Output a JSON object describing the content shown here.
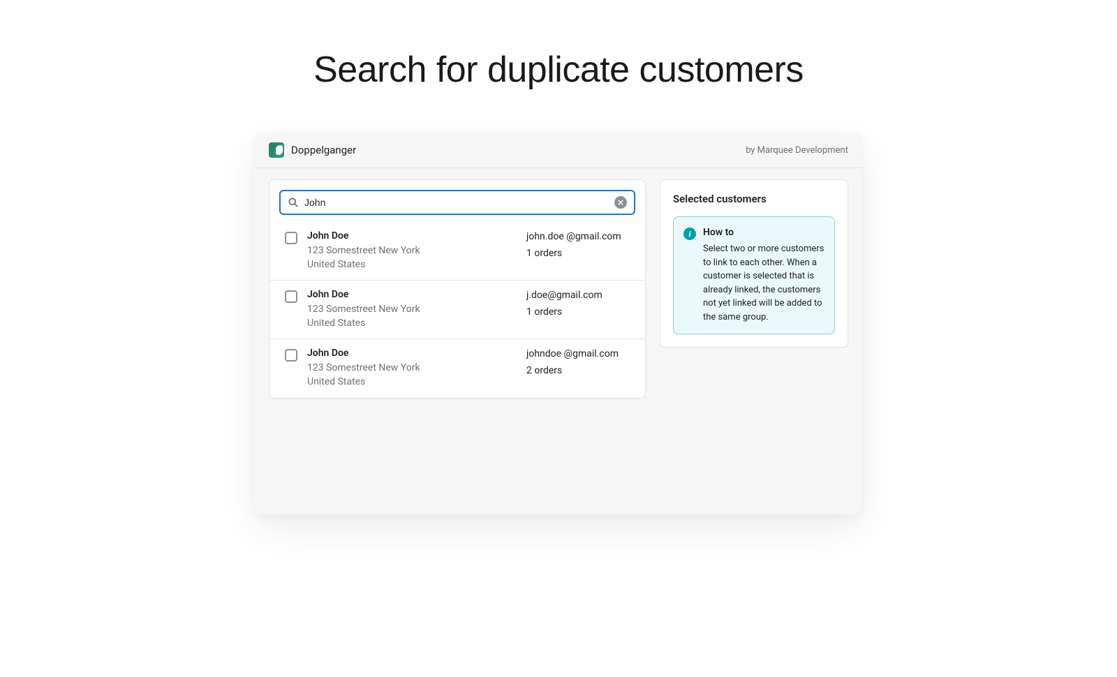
{
  "page": {
    "title": "Search for duplicate customers"
  },
  "header": {
    "app_name": "Doppelganger",
    "by_line": "by Marquee Development"
  },
  "search": {
    "value": "John"
  },
  "results": [
    {
      "name": "John Doe",
      "address": "123 Somestreet New York United States",
      "email": "john.doe @gmail.com",
      "orders": "1 orders"
    },
    {
      "name": "John Doe",
      "address": "123 Somestreet New York United States",
      "email": "j.doe@gmail.com",
      "orders": "1 orders"
    },
    {
      "name": "John Doe",
      "address": "123 Somestreet New York United States",
      "email": "johndoe @gmail.com",
      "orders": "2 orders"
    }
  ],
  "sidebar": {
    "title": "Selected customers",
    "howto_title": "How to",
    "howto_text": "Select two or more customers to link to each other. When a customer is selected that is already linked, the customers not yet linked will be added to the same group."
  }
}
